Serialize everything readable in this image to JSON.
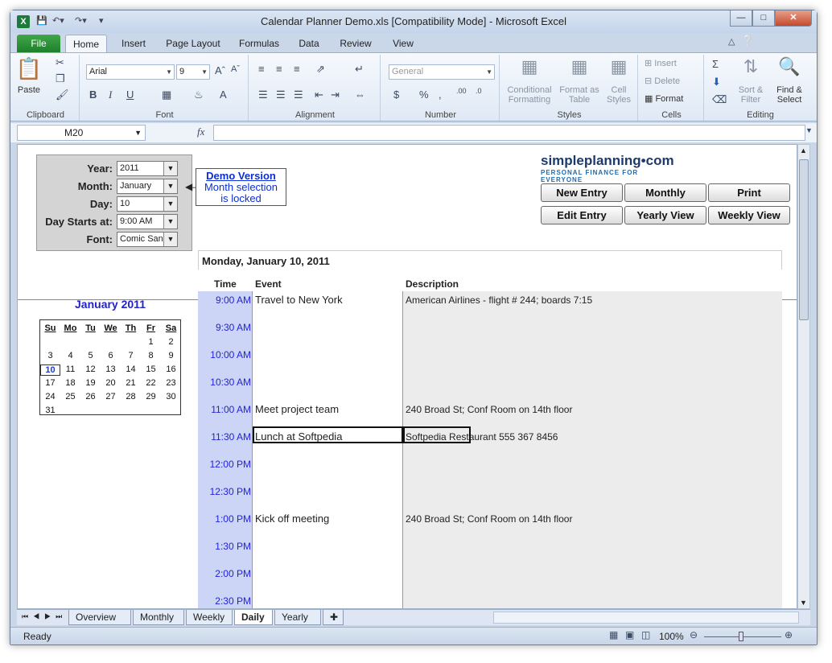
{
  "window": {
    "title": "Calendar Planner Demo.xls  [Compatibility Mode]  -  Microsoft Excel"
  },
  "tabs": {
    "file": "File",
    "home": "Home",
    "insert": "Insert",
    "page_layout": "Page Layout",
    "formulas": "Formulas",
    "data": "Data",
    "review": "Review",
    "view": "View"
  },
  "ribbon": {
    "clipboard": {
      "label": "Clipboard",
      "paste": "Paste"
    },
    "font": {
      "label": "Font",
      "name": "Arial",
      "size": "9"
    },
    "alignment": {
      "label": "Alignment"
    },
    "number": {
      "label": "Number",
      "format": "General"
    },
    "styles": {
      "label": "Styles",
      "conditional": "Conditional Formatting",
      "format_table": "Format as Table",
      "cell_styles": "Cell Styles"
    },
    "cells": {
      "label": "Cells",
      "insert": "Insert",
      "delete": "Delete",
      "format": "Format"
    },
    "editing": {
      "label": "Editing",
      "sort": "Sort & Filter",
      "find": "Find & Select"
    }
  },
  "formula_bar": {
    "name_box": "M20",
    "fx": "fx",
    "formula": ""
  },
  "panel": {
    "year_label": "Year:",
    "year": "2011",
    "month_label": "Month:",
    "month": "January",
    "day_label": "Day:",
    "day": "10",
    "day_starts_label": "Day Starts at:",
    "day_starts": "9:00 AM",
    "font_label": "Font:",
    "font": "Comic Sans"
  },
  "demo_note": {
    "title": "Demo Version",
    "line1": "Month selection",
    "line2": "is locked"
  },
  "logo": {
    "name": "simpleplanning•com",
    "tagline": "PERSONAL FINANCE FOR EVERYONE"
  },
  "buttons": {
    "new_entry": "New Entry",
    "monthly": "Monthly",
    "print": "Print",
    "edit_entry": "Edit Entry",
    "yearly_view": "Yearly View",
    "weekly_view": "Weekly View"
  },
  "schedule": {
    "date": "Monday, January 10, 2011",
    "headers": {
      "time": "Time",
      "event": "Event",
      "description": "Description"
    },
    "rows": [
      {
        "time": "9:00 AM",
        "event": "Travel to New York",
        "description": "American Airlines - flight # 244; boards 7:15"
      },
      {
        "time": "9:30 AM",
        "event": "",
        "description": ""
      },
      {
        "time": "10:00 AM",
        "event": "",
        "description": ""
      },
      {
        "time": "10:30 AM",
        "event": "",
        "description": ""
      },
      {
        "time": "11:00 AM",
        "event": "Meet project team",
        "description": "240 Broad St; Conf Room on 14th floor"
      },
      {
        "time": "11:30 AM",
        "event": "Lunch at Softpedia",
        "description": "Softpedia Restaurant 555 367 8456"
      },
      {
        "time": "12:00 PM",
        "event": "",
        "description": ""
      },
      {
        "time": "12:30 PM",
        "event": "",
        "description": ""
      },
      {
        "time": "1:00 PM",
        "event": "Kick off meeting",
        "description": "240 Broad St; Conf Room on 14th floor"
      },
      {
        "time": "1:30 PM",
        "event": "",
        "description": ""
      },
      {
        "time": "2:00 PM",
        "event": "",
        "description": ""
      },
      {
        "time": "2:30 PM",
        "event": "",
        "description": ""
      }
    ]
  },
  "mini_calendar": {
    "title": "January 2011",
    "weekdays": [
      "Su",
      "Mo",
      "Tu",
      "We",
      "Th",
      "Fr",
      "Sa"
    ],
    "weeks": [
      [
        "",
        "",
        "",
        "",
        "",
        "1",
        "2"
      ],
      [
        "3",
        "4",
        "5",
        "6",
        "7",
        "8",
        "9"
      ],
      [
        "10",
        "11",
        "12",
        "13",
        "14",
        "15",
        "16"
      ],
      [
        "17",
        "18",
        "19",
        "20",
        "21",
        "22",
        "23"
      ],
      [
        "24",
        "25",
        "26",
        "27",
        "28",
        "29",
        "30"
      ],
      [
        "31",
        "",
        "",
        "",
        "",
        "",
        ""
      ]
    ],
    "today": "10"
  },
  "sheet_tabs": [
    "Overview",
    "Monthly",
    "Weekly",
    "Daily",
    "Yearly"
  ],
  "active_sheet": "Daily",
  "status": {
    "ready": "Ready",
    "zoom": "100%"
  }
}
